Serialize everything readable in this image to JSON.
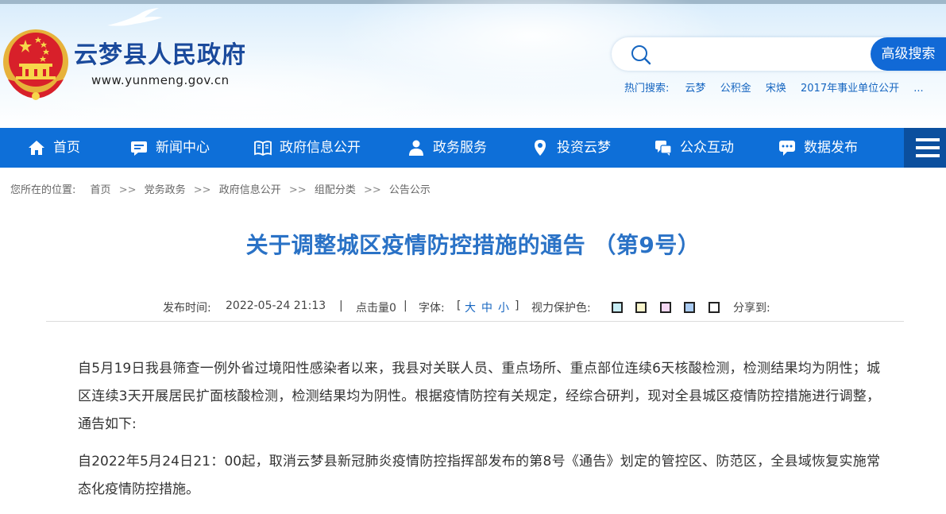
{
  "site": {
    "title": "云梦县人民政府",
    "url": "www.yunmeng.gov.cn"
  },
  "search": {
    "placeholder": "",
    "advanced_label": "高级搜索",
    "hot_label": "热门搜索:",
    "hot_terms": [
      "云梦",
      "公积金",
      "宋焕",
      "2017年事业单位公开",
      "..."
    ]
  },
  "nav": {
    "items": [
      {
        "label": "首页",
        "icon": "home-icon"
      },
      {
        "label": "新闻中心",
        "icon": "news-icon"
      },
      {
        "label": "政府信息公开",
        "icon": "book-icon"
      },
      {
        "label": "政务服务",
        "icon": "people-icon"
      },
      {
        "label": "投资云梦",
        "icon": "location-pin-icon"
      },
      {
        "label": "公众互动",
        "icon": "chat-icon"
      },
      {
        "label": "数据发布",
        "icon": "message-icon"
      }
    ],
    "menu_icon": "hamburger-menu-icon"
  },
  "breadcrumb": {
    "prefix": "您所在的位置:",
    "items": [
      "首页",
      "党务政务",
      "政府信息公开",
      "组配分类",
      "公告公示"
    ],
    "separator": ">>"
  },
  "article": {
    "title": "关于调整城区疫情防控措施的通告 （第9号）",
    "meta": {
      "publish_label": "发布时间:",
      "publish_time": "2022-05-24 21:13",
      "divider": "|",
      "clicks": "点击量0",
      "font_label": "字体:",
      "font_open": "[",
      "font_large": "大",
      "font_medium": "中",
      "font_small": "小",
      "font_close": "]",
      "eye_label": "视力保护色:",
      "share_label": "分享到:"
    },
    "paragraphs": [
      "自5月19日我县筛查一例外省过境阳性感染者以来，我县对关联人员、重点场所、重点部位连续6天核酸检测，检测结果均为阴性；城区连续3天开展居民扩面核酸检测，检测结果均为阴性。根据疫情防控有关规定，经综合研判，现对全县城区疫情防控措施进行调整，通告如下:",
      "自2022年5月24日21：00起，取消云梦县新冠肺炎疫情防控指挥部发布的第8号《通告》划定的管控区、防范区，全县域恢复实施常态化疫情防控措施。"
    ]
  },
  "colors": {
    "nav_bg": "#0e6fd8",
    "menu_bg": "#0b4f9e",
    "title_blue": "#2a72c6",
    "site_title": "#1a4a9c",
    "swatches": [
      "#c7edf5",
      "#faf6cc",
      "#f6d8f4",
      "#a9cbf2",
      "#ffffff"
    ]
  }
}
